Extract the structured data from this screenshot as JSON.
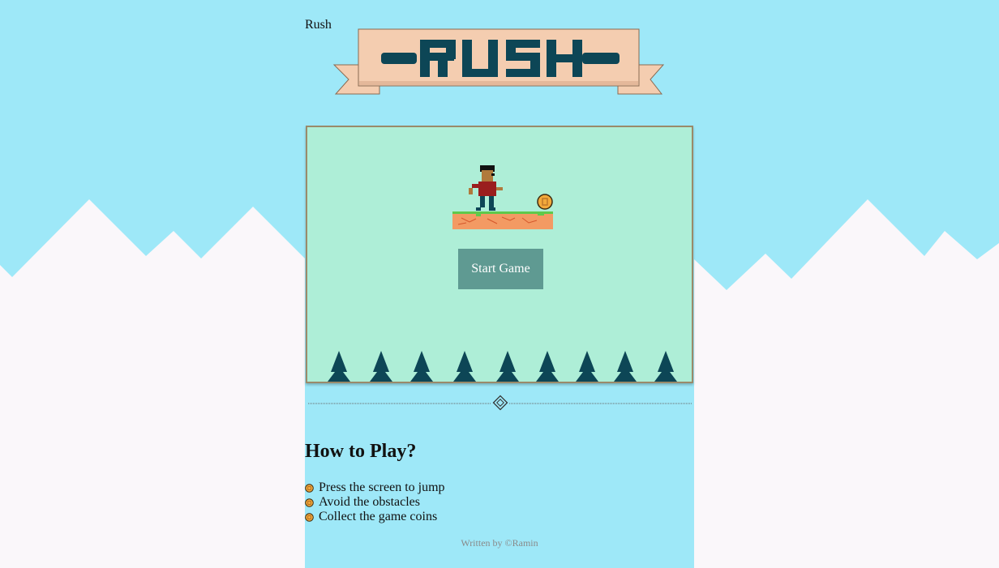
{
  "page": {
    "title": "Rush"
  },
  "banner": {
    "logo_text": "RUSH"
  },
  "game": {
    "start_button_label": "Start Game",
    "colors": {
      "frame_bg": "#aeeed7",
      "tree": "#0d4656",
      "platform": "#f39a63",
      "grass": "#5fc94b",
      "coin": "#f2a93b"
    }
  },
  "how_to_play": {
    "title": "How to Play?",
    "rules": [
      "Press the screen to jump",
      "Avoid the obstacles",
      "Collect the game coins"
    ]
  },
  "footer": {
    "credit": "Written by ©Ramin"
  },
  "theme": {
    "sky": "#9ee8f8",
    "snow": "#faf7fa",
    "banner_fill": "#f4cdb0",
    "logo_color": "#0d4656"
  }
}
